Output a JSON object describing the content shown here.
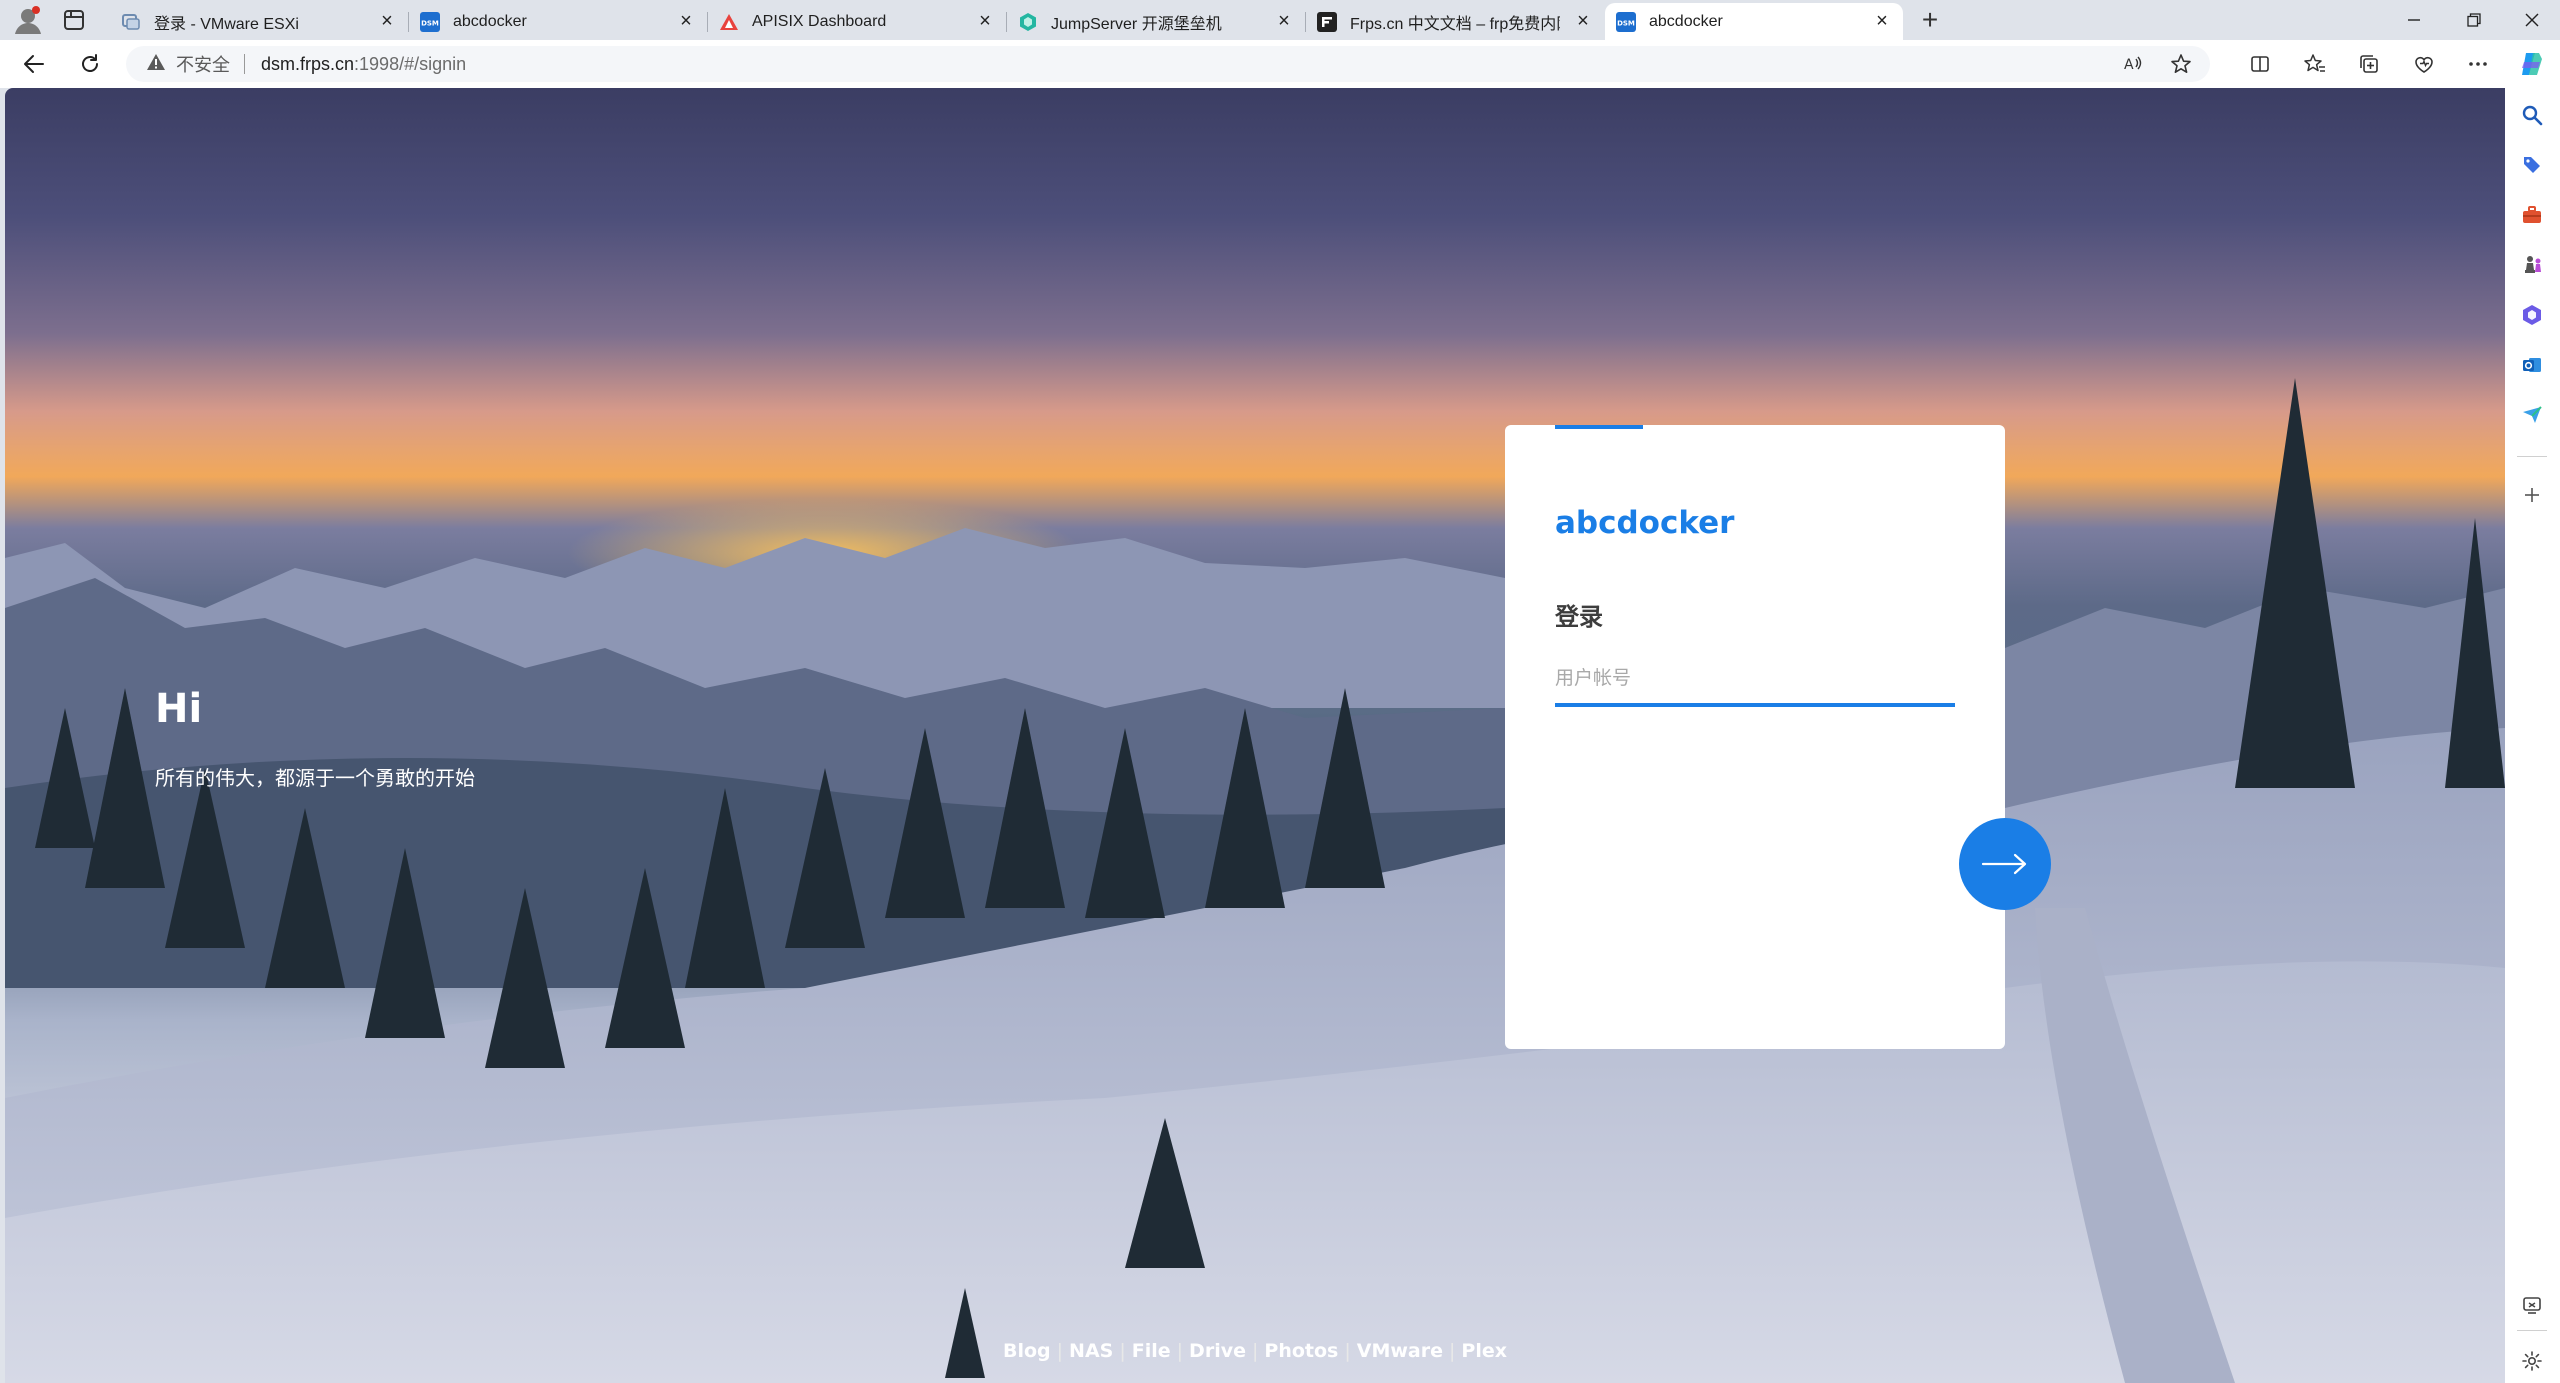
{
  "browser": {
    "tabs": [
      {
        "title": "登录 - VMware ESXi",
        "favicon": "vmware-icon",
        "active": false
      },
      {
        "title": "abcdocker",
        "favicon": "dsm-icon",
        "active": false
      },
      {
        "title": "APISIX Dashboard",
        "favicon": "apisix-icon",
        "active": false
      },
      {
        "title": "JumpServer 开源堡垒机",
        "favicon": "jumpserver-icon",
        "active": false
      },
      {
        "title": "Frps.cn 中文文档 – frp免费内网穿",
        "favicon": "frps-icon",
        "active": false
      },
      {
        "title": "abcdocker",
        "favicon": "dsm-icon",
        "active": true
      }
    ],
    "favicon_text": {
      "dsm": "DSM"
    },
    "address_bar": {
      "security_label": "不安全",
      "url_host": "dsm.frps.cn",
      "url_path": ":1998/#/signin"
    },
    "accent_color": "#1a7ee6"
  },
  "page": {
    "hero": {
      "title": "Hi",
      "subtitle": "所有的伟大，都源于一个勇敢的开始"
    },
    "login": {
      "brand": "abcdocker",
      "title": "登录",
      "username_placeholder": "用户帐号",
      "username_value": ""
    },
    "footer_links": [
      "Blog",
      "NAS",
      "File",
      "Drive",
      "Photos",
      "VMware",
      "Plex"
    ],
    "footer_separator": "|"
  }
}
